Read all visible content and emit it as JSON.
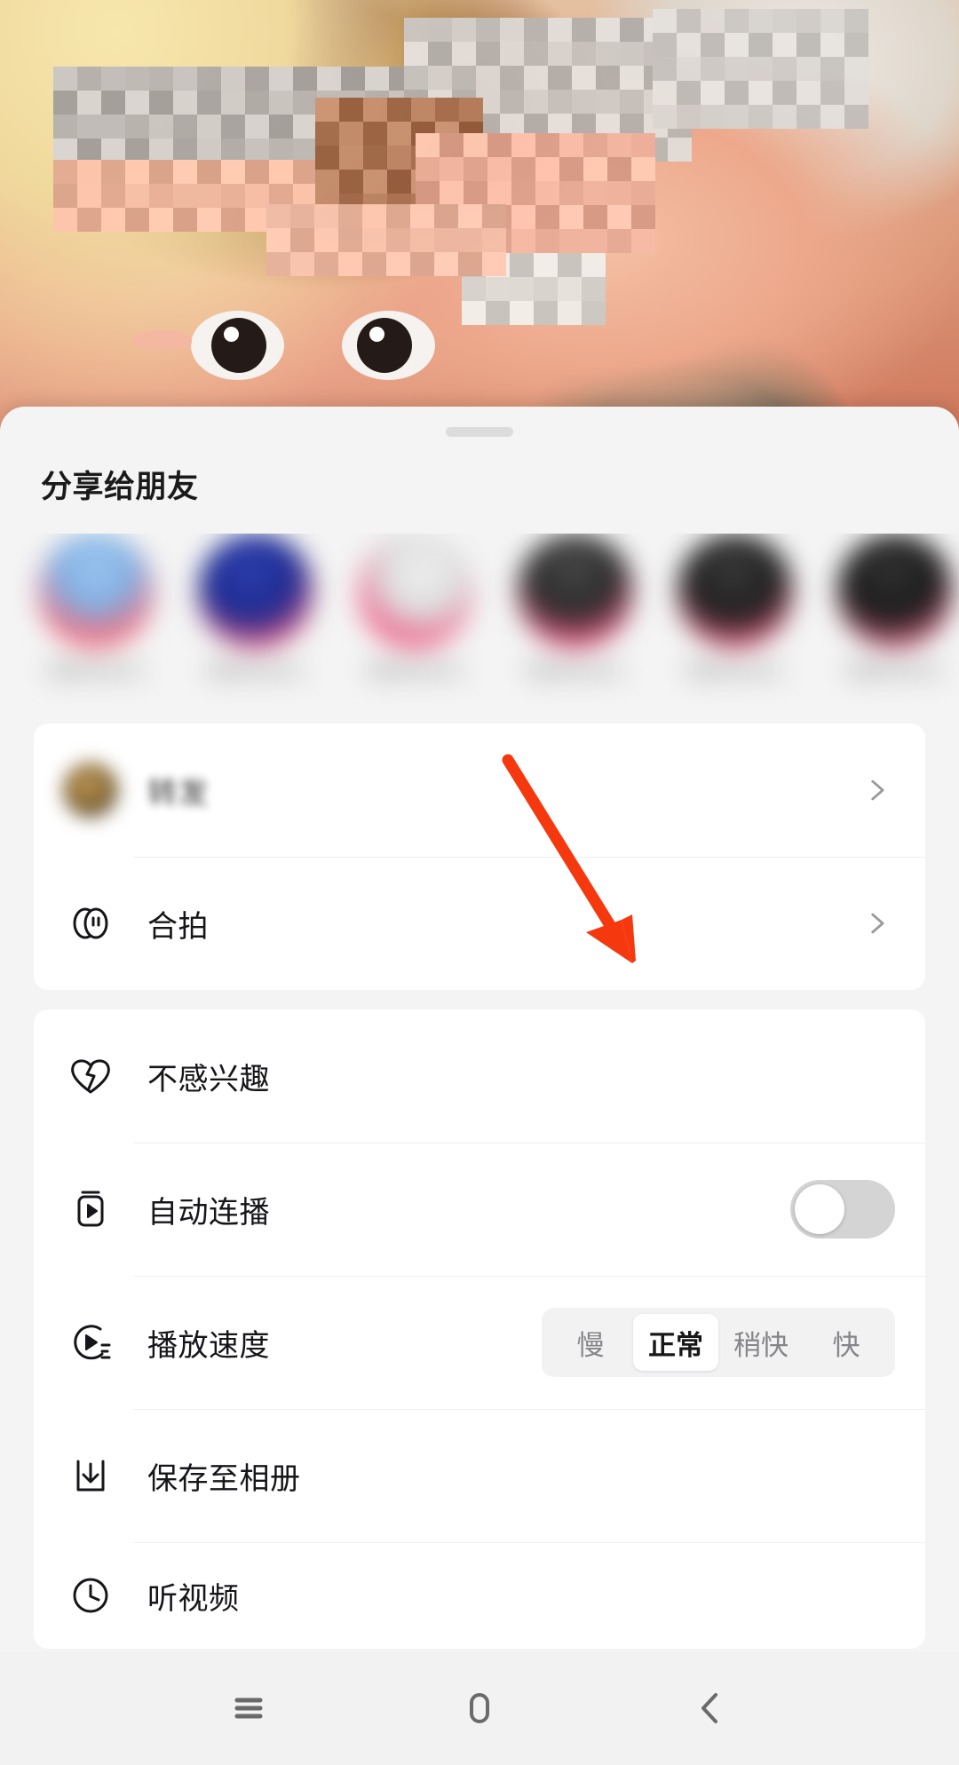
{
  "app": {
    "screen_name": "短视频分享面板"
  },
  "video": {
    "description": "视频画面（人物比心手势，已打码）"
  },
  "sheet": {
    "grabber": "drag-handle",
    "title": "分享给朋友",
    "friends": [
      {
        "name": "",
        "blurred": true
      },
      {
        "name": "",
        "blurred": true
      },
      {
        "name": "",
        "blurred": true
      },
      {
        "name": "",
        "blurred": true
      },
      {
        "name": "",
        "blurred": true
      },
      {
        "name": "",
        "blurred": true
      }
    ],
    "card1": [
      {
        "icon": "avatar-icon",
        "label": "转发",
        "blurred": true,
        "accessory": "chevron"
      },
      {
        "icon": "duet-icon",
        "label": "合拍",
        "blurred": false,
        "accessory": "chevron"
      }
    ],
    "card2": [
      {
        "icon": "broken-heart-icon",
        "label": "不感兴趣",
        "accessory": "none"
      },
      {
        "icon": "autoplay-icon",
        "label": "自动连播",
        "accessory": "toggle",
        "toggle_on": false
      },
      {
        "icon": "speed-icon",
        "label": "播放速度",
        "accessory": "segmented",
        "options": [
          "慢",
          "正常",
          "稍快",
          "快"
        ],
        "selected": "正常"
      },
      {
        "icon": "download-icon",
        "label": "保存至相册",
        "accessory": "none"
      },
      {
        "icon": "clock-icon",
        "label": "听视频",
        "accessory": "none",
        "cut_off": true
      }
    ]
  },
  "annotation": {
    "type": "arrow",
    "color": "#F5380E",
    "points_to": "自动连播开关"
  },
  "navbar": {
    "buttons": [
      {
        "name": "recents-icon",
        "label": "菜单"
      },
      {
        "name": "home-icon",
        "label": "主页"
      },
      {
        "name": "back-icon",
        "label": "返回"
      }
    ]
  },
  "colors": {
    "sheet_bg": "#F4F4F4",
    "card_bg": "#FFFFFF",
    "text_primary": "#16161A",
    "text_muted": "#85858A",
    "toggle_off_track": "#D4D4D4",
    "accent_annotation": "#F5380E",
    "navbar_bg": "#F2F2F2"
  }
}
